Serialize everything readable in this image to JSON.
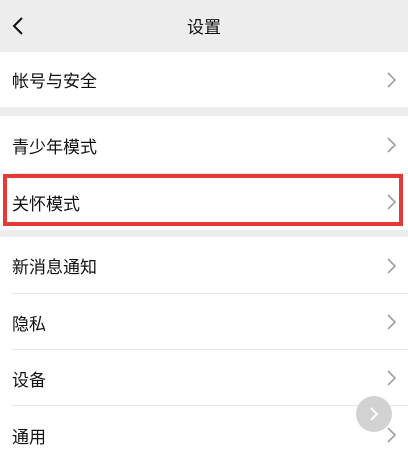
{
  "header": {
    "title": "设置",
    "back_icon": "chevron-left-icon"
  },
  "groups": [
    {
      "items": [
        {
          "label": "帐号与安全",
          "icon": "chevron-right-icon"
        }
      ]
    },
    {
      "items": [
        {
          "label": "青少年模式",
          "icon": "chevron-right-icon"
        },
        {
          "label": "关怀模式",
          "icon": "chevron-right-icon",
          "highlighted": true
        }
      ]
    },
    {
      "items": [
        {
          "label": "新消息通知",
          "icon": "chevron-right-icon"
        },
        {
          "label": "隐私",
          "icon": "chevron-right-icon"
        },
        {
          "label": "设备",
          "icon": "chevron-right-icon"
        },
        {
          "label": "通用",
          "icon": "chevron-right-icon"
        }
      ]
    }
  ],
  "floating_button": {
    "icon": "chevron-right-icon"
  },
  "colors": {
    "background": "#ededed",
    "row": "#ffffff",
    "highlight": "#e53935"
  }
}
